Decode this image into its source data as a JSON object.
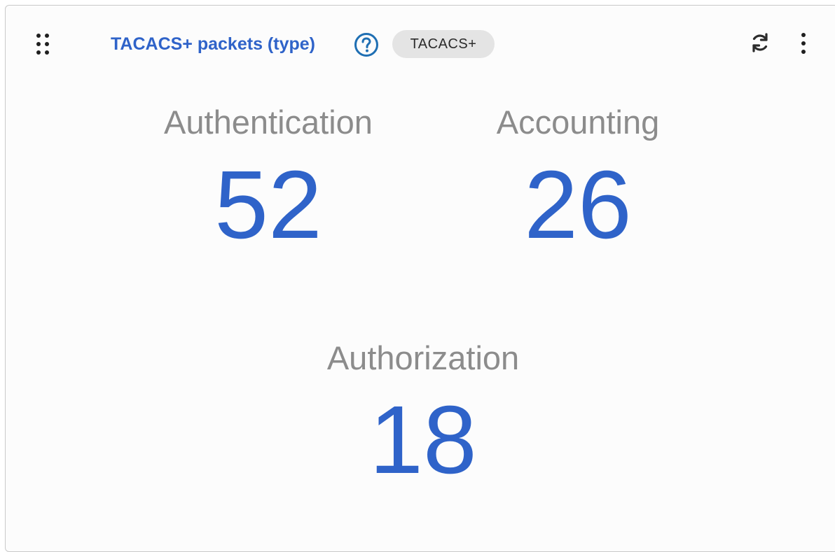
{
  "widget": {
    "title": "TACACS+ packets (type)",
    "tag": "TACACS+",
    "icons": {
      "drag": "drag-handle-icon",
      "help": "help-circle-icon",
      "refresh": "refresh-icon",
      "more": "more-vertical-icon"
    },
    "accent_color": "#2f63c9"
  },
  "metrics": [
    {
      "label": "Authentication",
      "value": "52"
    },
    {
      "label": "Accounting",
      "value": "26"
    },
    {
      "label": "Authorization",
      "value": "18"
    }
  ]
}
